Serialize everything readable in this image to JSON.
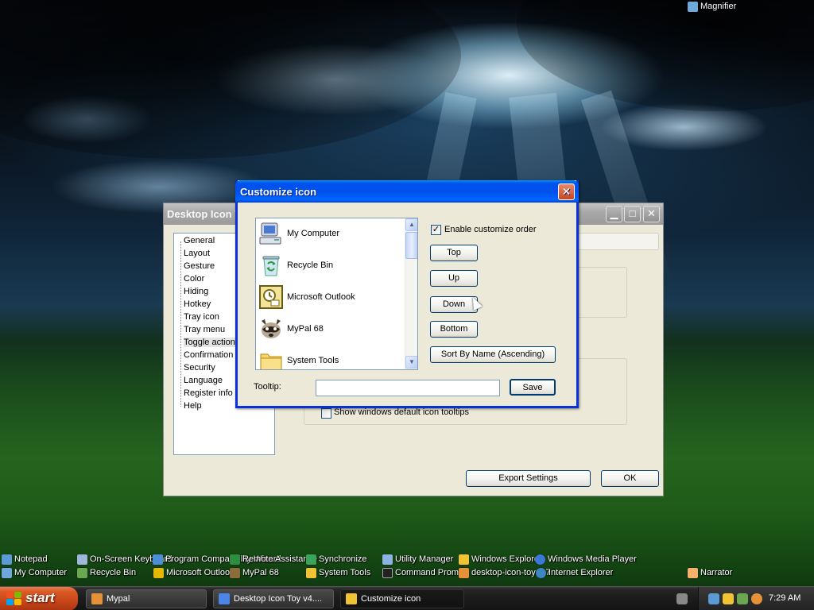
{
  "desktop": {
    "top_right": {
      "label": "Magnifier"
    },
    "row1": [
      {
        "label": "Notepad",
        "color": "#5b9bd5"
      },
      {
        "label": "On-Screen Keyboard",
        "color": "#9fb7d9"
      },
      {
        "label": "Program Compatibility Wizard",
        "color": "#4c8fd6"
      },
      {
        "label": "Remote Assistance",
        "color": "#2c8e3e"
      },
      {
        "label": "Synchronize",
        "color": "#3aa55a"
      },
      {
        "label": "Utility Manager",
        "color": "#8db3e2"
      },
      {
        "label": "Windows Explorer",
        "color": "#f1c232"
      },
      {
        "label": "Windows Media Player",
        "color": "#3c78d8"
      }
    ],
    "row2": [
      {
        "label": "My Computer",
        "color": "#6fa8dc"
      },
      {
        "label": "Recycle Bin",
        "color": "#6aa84f"
      },
      {
        "label": "Microsoft Outlook",
        "color": "#e6b800"
      },
      {
        "label": "MyPal 68",
        "color": "#8a6d3b"
      },
      {
        "label": "System Tools",
        "color": "#f1c232"
      },
      {
        "label": "Command Prompt",
        "color": "#222222"
      },
      {
        "label": "desktop-icon-toy-4.7",
        "color": "#e69138"
      },
      {
        "label": "Internet Explorer",
        "color": "#3d85c6"
      },
      {
        "label": "Narrator",
        "color": "#f6b26b"
      }
    ]
  },
  "main_window": {
    "title": "Desktop Icon Toy v4.7",
    "tree": [
      "General",
      "Layout",
      "Gesture",
      "Color",
      "Hiding",
      "Hotkey",
      "Tray icon",
      "Tray menu",
      "Toggle action",
      "Confirmation",
      "Security",
      "Language",
      "Register info",
      "Help"
    ],
    "show_tooltips_label": "Show windows default icon tooltips",
    "export_label": "Export Settings",
    "ok_label": "OK"
  },
  "dialog": {
    "title": "Customize icon",
    "close_glyph": "✕",
    "list_items": [
      {
        "label": "My Computer"
      },
      {
        "label": "Recycle Bin"
      },
      {
        "label": "Microsoft Outlook"
      },
      {
        "label": "MyPal 68"
      },
      {
        "label": "System Tools"
      }
    ],
    "enable_label": "Enable customize order",
    "enable_checked": true,
    "top_label": "Top",
    "up_label": "Up",
    "down_label": "Down",
    "bottom_label": "Bottom",
    "sort_label": "Sort By Name (Ascending)",
    "tooltip_label": "Tooltip:",
    "tooltip_value": "",
    "save_label": "Save"
  },
  "taskbar": {
    "start_label": "start",
    "tasks": [
      {
        "label": "Mypal",
        "color": "#e69138"
      },
      {
        "label": "Desktop Icon Toy v4....",
        "color": "#4a86e8"
      },
      {
        "label": "Customize icon",
        "color": "#f1c232"
      }
    ],
    "clock": "7:29 AM"
  }
}
